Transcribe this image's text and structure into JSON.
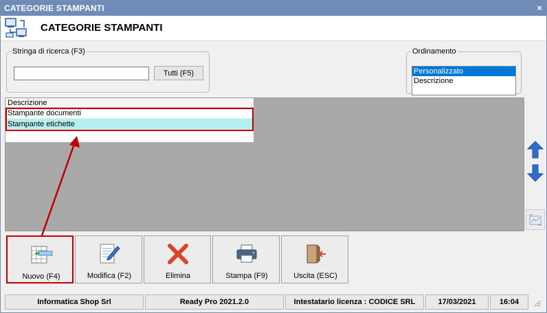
{
  "window": {
    "title": "CATEGORIE STAMPANTI",
    "close_glyph": "×"
  },
  "header": {
    "title": "CATEGORIE STAMPANTI",
    "icon": "network-icon"
  },
  "search": {
    "legend": "Stringa di ricerca (F3)",
    "value": "",
    "placeholder": "",
    "all_button": "Tutti (F5)"
  },
  "ordering": {
    "legend": "Ordinamento",
    "options": [
      "Personalizzato",
      "Descrizione"
    ],
    "selected_index": 0
  },
  "grid": {
    "column_header": "Descrizione",
    "rows": [
      "Stampante documenti",
      "Stampante etichette"
    ],
    "selected_index": 1
  },
  "toolbar": {
    "new": "Nuovo (F4)",
    "edit": "Modifica (F2)",
    "delete": "Elimina",
    "print": "Stampa (F9)",
    "exit": "Uscita (ESC)"
  },
  "status": {
    "company": "Informatica Shop Srl",
    "product": "Ready Pro 2021.2.0",
    "license": "Intestatario licenza : CODICE SRL",
    "date": "17/03/2021",
    "time": "16:04"
  },
  "colors": {
    "titlebar": "#6f8cb8",
    "selection": "#0078d7",
    "row_selected": "#b4f0f0",
    "highlight": "#c00000",
    "arrow_blue": "#2f6fc9"
  }
}
